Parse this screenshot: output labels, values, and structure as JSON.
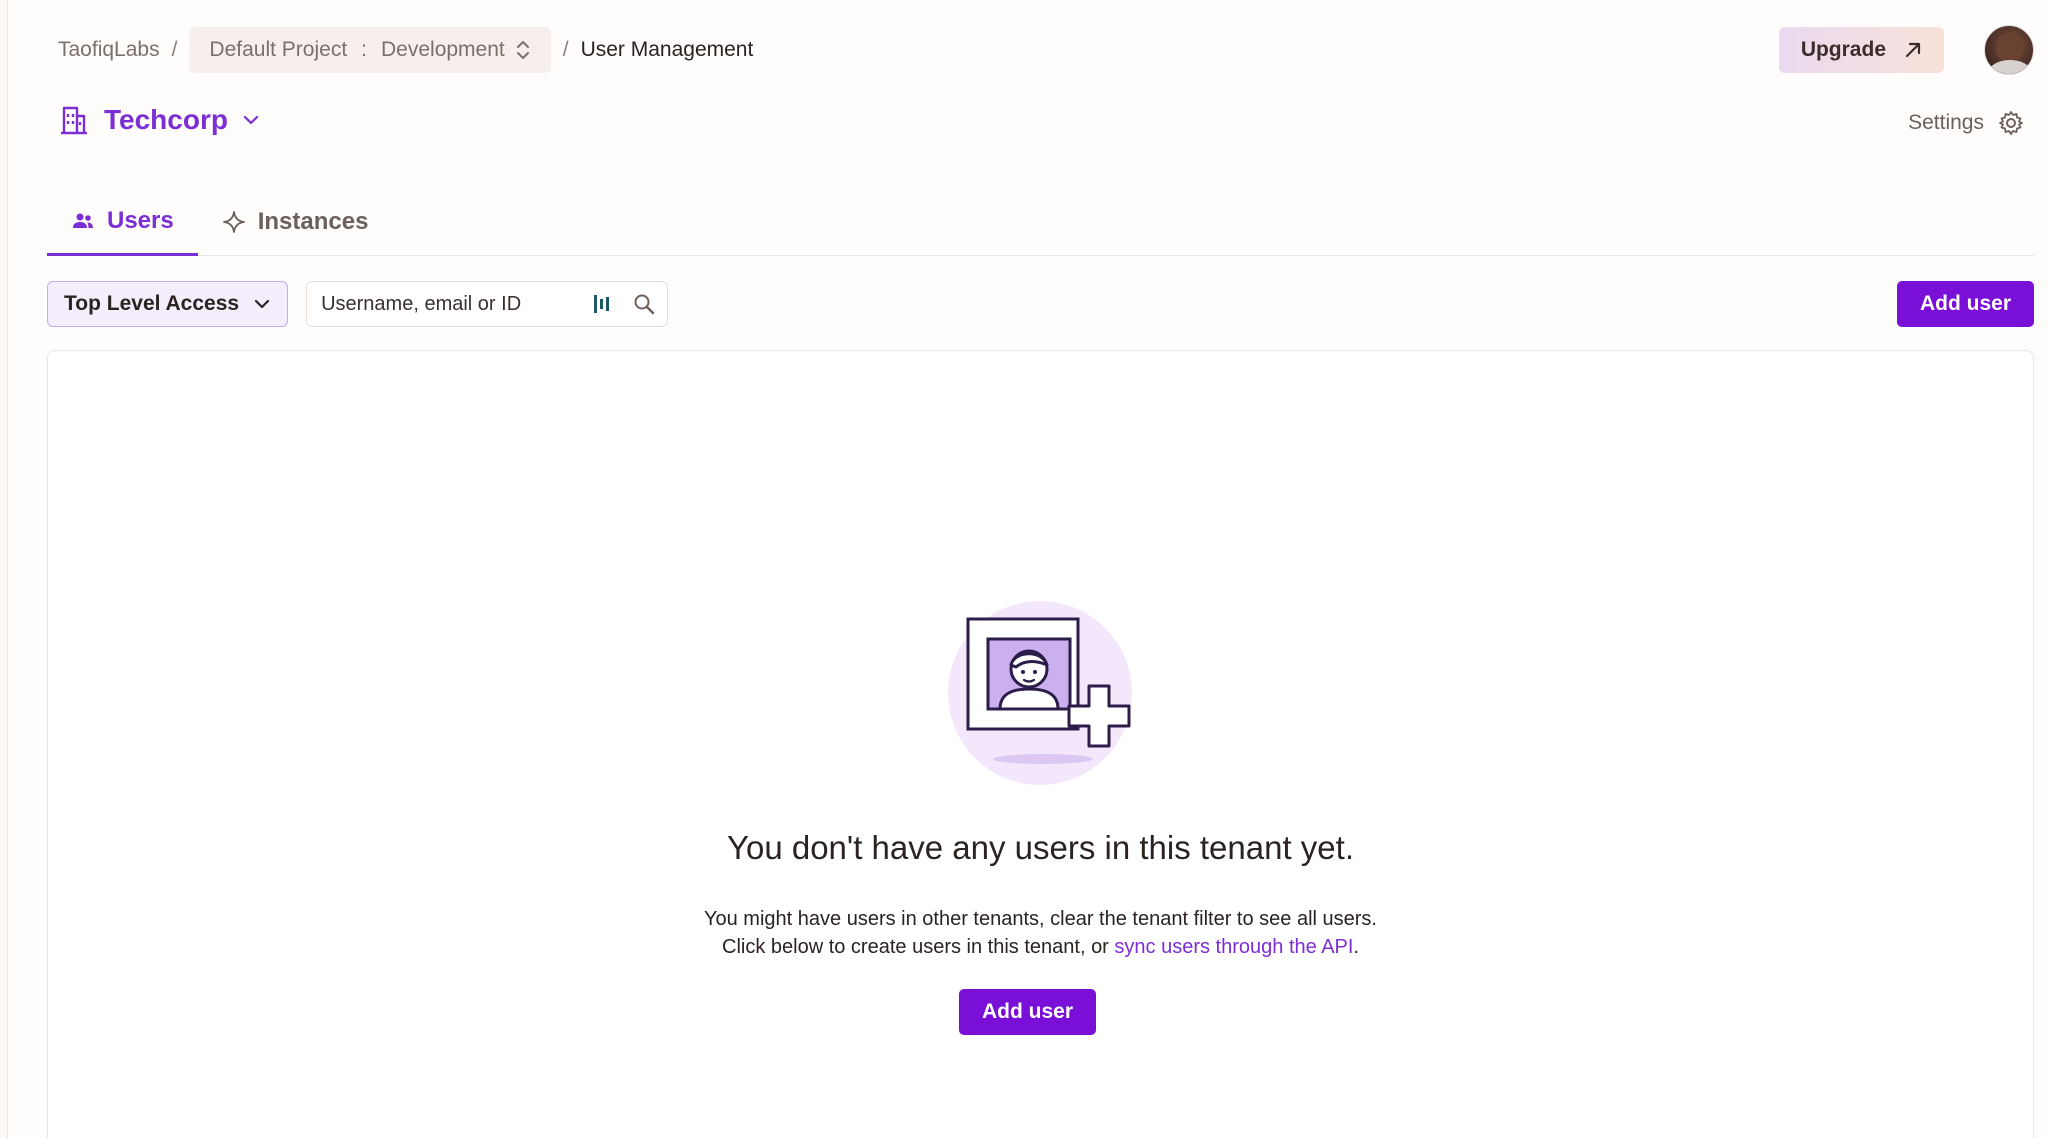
{
  "breadcrumb": {
    "org": "TaofiqLabs",
    "separator": "/",
    "project": "Default Project",
    "colon": ":",
    "environment": "Development",
    "current": "User Management"
  },
  "header": {
    "upgrade_label": "Upgrade",
    "avatar_icon": "user-avatar"
  },
  "tenant": {
    "name": "Techcorp",
    "icon": "building-icon"
  },
  "settings": {
    "label": "Settings",
    "icon": "gear-icon"
  },
  "tabs": [
    {
      "label": "Users",
      "icon": "users-icon",
      "active": true
    },
    {
      "label": "Instances",
      "icon": "sparkle-icon",
      "active": false
    }
  ],
  "toolbar": {
    "filter_label": "Top Level Access",
    "search_placeholder": "Username, email or ID",
    "add_user_label": "Add user"
  },
  "empty_state": {
    "title": "You don't have any users in this tenant yet.",
    "line1": "You might have users in other tenants, clear the tenant filter to see all users.",
    "line2_prefix": "Click below to create users in this tenant, or ",
    "line2_link": "sync users through the API",
    "line2_suffix": ".",
    "add_user_label": "Add user"
  },
  "colors": {
    "accent": "#7c2ed4",
    "primary_button": "#7a0fd8",
    "background": "#fefdfc"
  }
}
